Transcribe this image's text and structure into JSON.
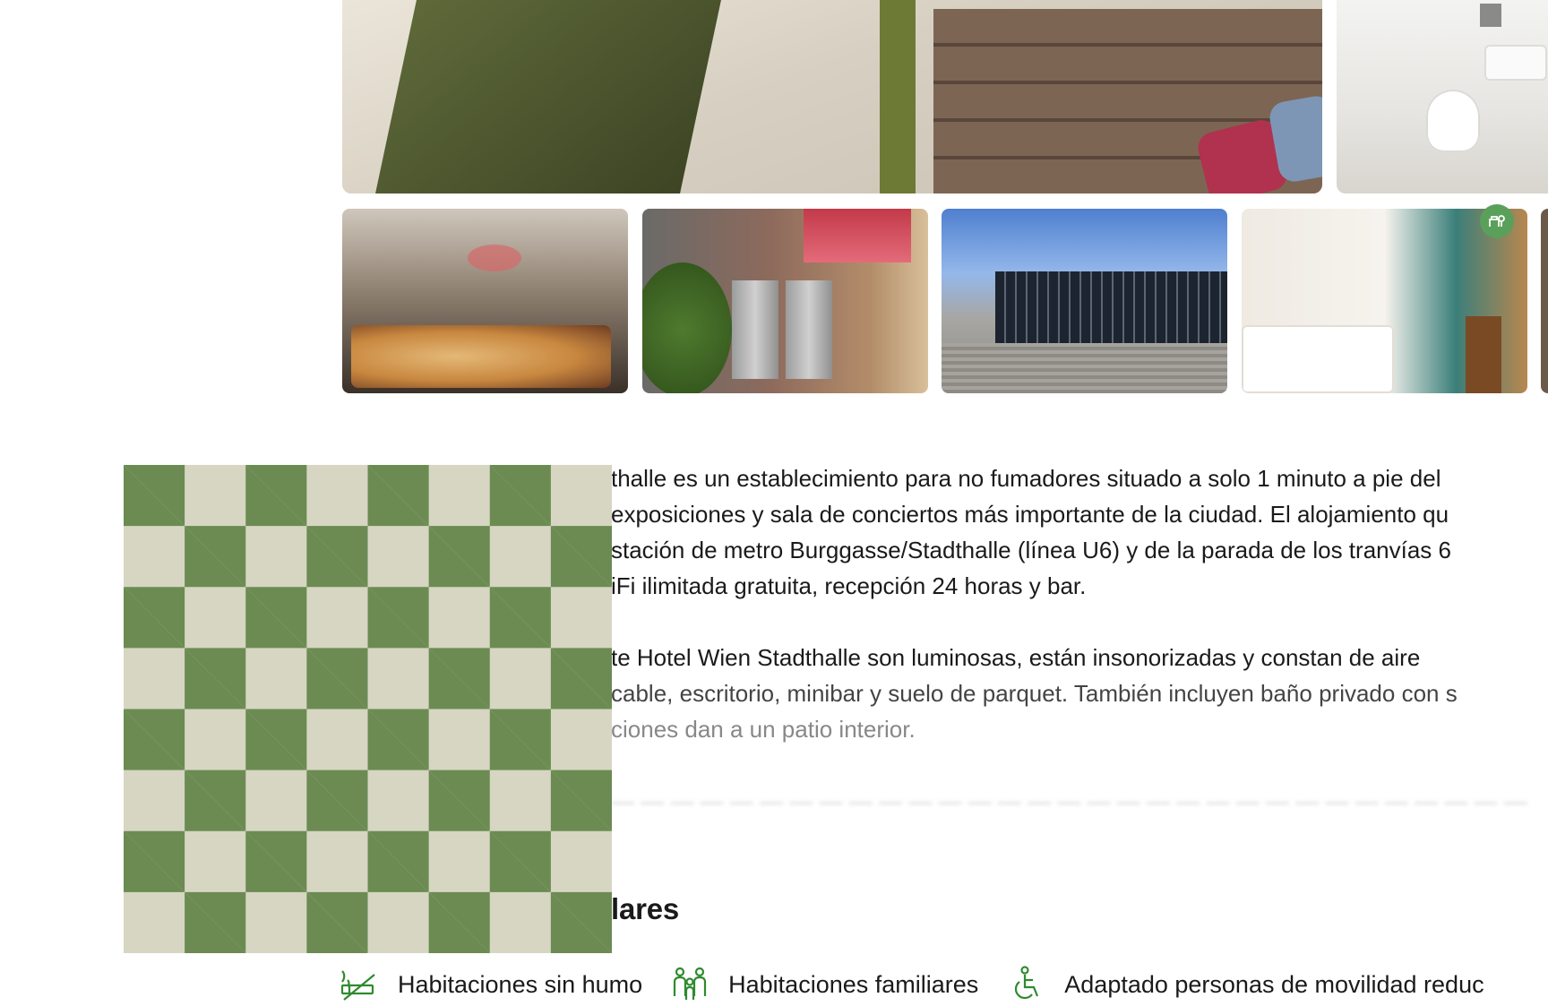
{
  "gallery": {
    "main_photo": "hotel-lounge-photo",
    "side_photo": "bathroom-photo",
    "thumbnails": [
      "breakfast-buffet-photo",
      "lobby-elevators-photo",
      "stadthalle-exterior-photo",
      "hotel-room-photo",
      "partial-photo"
    ],
    "badge_icon": "eco-certificate-icon"
  },
  "description": {
    "p1": [
      "thalle es un establecimiento para no fumadores situado a solo 1 minuto a pie del",
      " exposiciones y sala de conciertos más importante de la ciudad. El alojamiento qu",
      "stación de metro Burggasse/Stadthalle (línea U6) y de la parada de los tranvías 6",
      "iFi ilimitada gratuita, recepción 24 horas y bar."
    ],
    "p2": [
      "te Hotel Wien Stadthalle son luminosas, están insonorizadas y constan de aire",
      "cable, escritorio, minibar y suelo de parquet. También incluyen baño privado con s",
      "ciones dan a un patio interior."
    ]
  },
  "placeholder_image": "checkerboard-placeholder",
  "section": {
    "heading": "lares"
  },
  "facilities": [
    {
      "label": "Habitaciones sin humo",
      "icon": "no-smoking-icon"
    },
    {
      "label": "Habitaciones familiares",
      "icon": "family-icon"
    },
    {
      "label": "Adaptado personas de movilidad reduc",
      "icon": "wheelchair-icon"
    }
  ],
  "colors": {
    "accent_green": "#008009",
    "checker_dark": "#6b8b52",
    "checker_light": "#d6d6c2",
    "text": "#1a1a1a"
  }
}
